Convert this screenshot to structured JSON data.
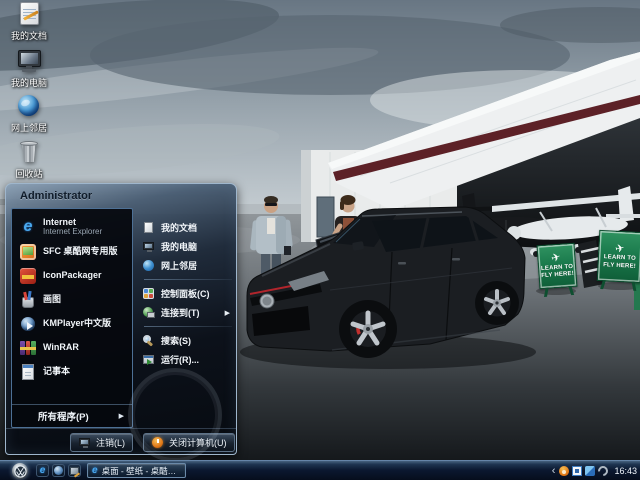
{
  "desktop": {
    "icons": [
      {
        "name": "my-documents",
        "label": "我的文档"
      },
      {
        "name": "my-computer",
        "label": "我的电脑"
      },
      {
        "name": "network-places",
        "label": "网上邻居"
      },
      {
        "name": "recycle-bin",
        "label": "回收站"
      }
    ]
  },
  "wallpaper": {
    "sign_line1": "LEARN TO",
    "sign_line2": "FLY HERE!"
  },
  "start_menu": {
    "username": "Administrator",
    "pinned": [
      {
        "label": "Internet",
        "sublabel": "Internet Explorer",
        "icon": "internet-explorer-icon"
      },
      {
        "label": "SFC 桌酷网专用版",
        "icon": "sfc-browser-icon"
      },
      {
        "label": "IconPackager",
        "icon": "iconpackager-icon"
      },
      {
        "label": "画图",
        "icon": "paint-icon"
      },
      {
        "label": "KMPlayer中文版",
        "icon": "kmplayer-icon"
      },
      {
        "label": "WinRAR",
        "icon": "winrar-icon"
      },
      {
        "label": "记事本",
        "icon": "notepad-icon"
      }
    ],
    "all_programs": "所有程序(P)",
    "places": [
      {
        "label": "我的文档",
        "icon": "my-documents-icon"
      },
      {
        "label": "我的电脑",
        "icon": "my-computer-icon"
      },
      {
        "label": "网上邻居",
        "icon": "network-places-icon"
      },
      {
        "label": "控制面板(C)",
        "icon": "control-panel-icon"
      },
      {
        "label": "连接到(T)",
        "icon": "connect-to-icon",
        "has_submenu": true
      },
      {
        "label": "搜索(S)",
        "icon": "search-icon"
      },
      {
        "label": "运行(R)...",
        "icon": "run-icon"
      }
    ],
    "log_off": "注销(L)",
    "shut_down": "关闭计算机(U)"
  },
  "taskbar": {
    "task": {
      "label": "桌面 - 壁纸 - 桌酷壁...",
      "icon": "internet-explorer-icon"
    },
    "clock": "16:43"
  },
  "glyphs": {
    "ie": "e",
    "chevron": "‹",
    "plane": "✈",
    "arrow_right": "▶"
  },
  "colors": {
    "sign_green": "#1a7a4c",
    "roof_maroon": "#5d2127",
    "taskbar_blue": "#1d3450",
    "accent_red_stripe": "#b2252c"
  }
}
